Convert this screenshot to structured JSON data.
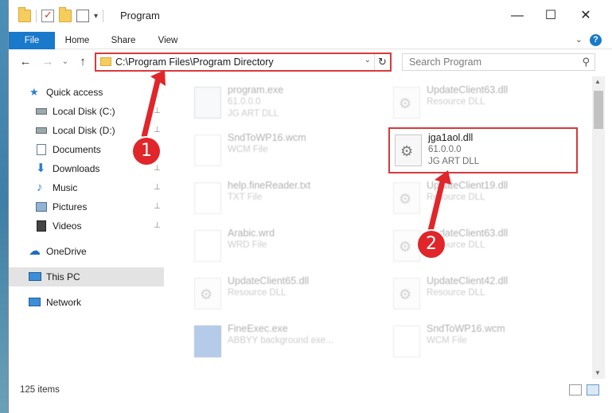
{
  "window": {
    "title": "Program",
    "minimize": "—",
    "maximize": "☐",
    "close": "✕"
  },
  "ribbon": {
    "tabs": [
      "File",
      "Home",
      "Share",
      "View"
    ],
    "help": "?",
    "collapse": "⌄"
  },
  "nav": {
    "back": "←",
    "forward": "→",
    "recent": "⌄",
    "up": "↑",
    "address": "C:\\Program Files\\Program Directory",
    "address_dropdown": "⌄",
    "refresh": "↻",
    "search_placeholder": "Search Program",
    "search_icon": "⚲"
  },
  "sidebar": {
    "items": [
      {
        "label": "Quick access",
        "icon": "star-icon",
        "pinned": false
      },
      {
        "label": "Local Disk (C:)",
        "icon": "drive-icon",
        "pinned": true
      },
      {
        "label": "Local Disk (D:)",
        "icon": "drive-icon",
        "pinned": true
      },
      {
        "label": "Documents",
        "icon": "documents-icon",
        "pinned": true
      },
      {
        "label": "Downloads",
        "icon": "download-icon",
        "pinned": true
      },
      {
        "label": "Music",
        "icon": "music-icon",
        "pinned": true
      },
      {
        "label": "Pictures",
        "icon": "pictures-icon",
        "pinned": true
      },
      {
        "label": "Videos",
        "icon": "videos-icon",
        "pinned": true
      },
      {
        "label": "OneDrive",
        "icon": "cloud-icon",
        "pinned": false
      },
      {
        "label": "This PC",
        "icon": "computer-icon",
        "pinned": false,
        "selected": true
      },
      {
        "label": "Network",
        "icon": "network-icon",
        "pinned": false
      }
    ],
    "pin_glyph": "📌"
  },
  "files": [
    {
      "name": "program.exe",
      "line1": "61.0.0.0",
      "line2": "JG ART DLL",
      "icon": "exe-icon"
    },
    {
      "name": "UpdateClient63.dll",
      "line1": "Resource DLL",
      "line2": "",
      "icon": "dll-icon"
    },
    {
      "name": "SndToWP16.wcm",
      "line1": "WCM File",
      "line2": "",
      "icon": "doc-icon"
    },
    {
      "name": "jga1aol.dll",
      "line1": "61.0.0.0",
      "line2": "JG ART DLL",
      "icon": "dll-icon"
    },
    {
      "name": "help.fineReader.txt",
      "line1": "TXT File",
      "line2": "",
      "icon": "doc-icon"
    },
    {
      "name": "UpdateClient19.dll",
      "line1": "Resource DLL",
      "line2": "",
      "icon": "dll-icon"
    },
    {
      "name": "Arabic.wrd",
      "line1": "WRD File",
      "line2": "",
      "icon": "doc-icon"
    },
    {
      "name": "UpdateClient63.dll",
      "line1": "Resource DLL",
      "line2": "",
      "icon": "dll-icon"
    },
    {
      "name": "UpdateClient65.dll",
      "line1": "Resource DLL",
      "line2": "",
      "icon": "dll-icon"
    },
    {
      "name": "UpdateClient42.dll",
      "line1": "Resource DLL",
      "line2": "",
      "icon": "dll-icon"
    },
    {
      "name": "FineExec.exe",
      "line1": "ABBYY background exe...",
      "line2": "",
      "icon": "blue-exe-icon"
    },
    {
      "name": "SndToWP16.wcm",
      "line1": "WCM File",
      "line2": "",
      "icon": "doc-icon"
    }
  ],
  "status": {
    "item_count": "125 items"
  },
  "annotations": {
    "step1": "1",
    "step2": "2",
    "color": "#e0262a"
  }
}
